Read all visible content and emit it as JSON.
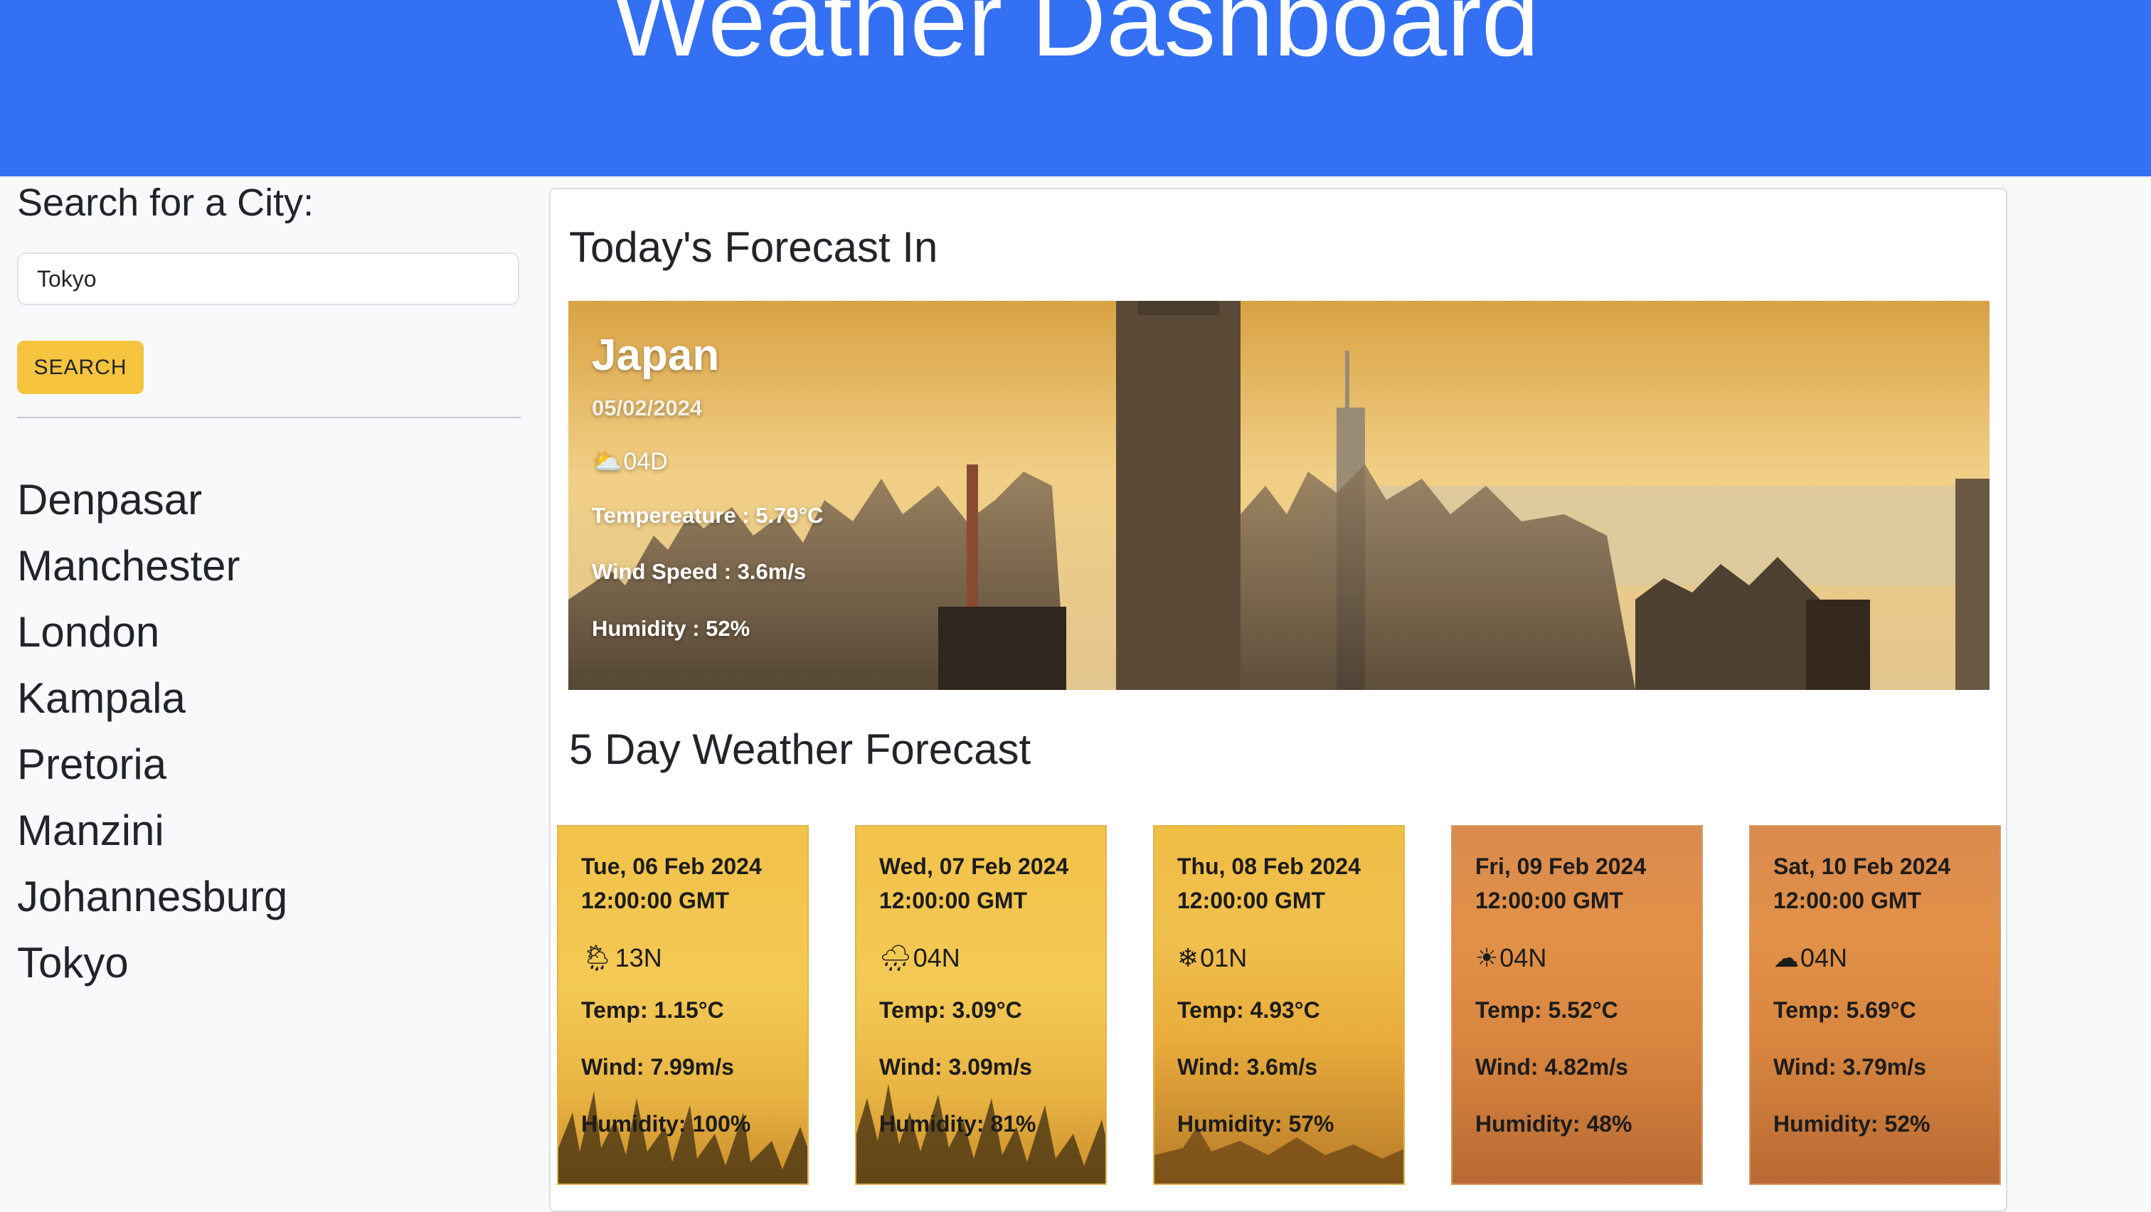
{
  "header": {
    "title": "Weather Dashboard"
  },
  "sidebar": {
    "search_label": "Search for a City:",
    "search_value": "Tokyo",
    "search_button": "SEARCH",
    "cities": [
      "Denpasar",
      "Manchester",
      "London",
      "Kampala",
      "Pretoria",
      "Manzini",
      "Johannesburg",
      "Tokyo"
    ]
  },
  "today": {
    "heading": "Today's Forecast In",
    "country": "Japan",
    "date": "05/02/2024",
    "icon_code": "04D",
    "icon": "sun-cloud-icon",
    "temperature": "Tempereature : 5.79°C",
    "wind": "Wind Speed : 3.6m/s",
    "humidity": "Humidity : 52%"
  },
  "forecast": {
    "heading": "5 Day Weather Forecast",
    "days": [
      {
        "date": "Tue, 06 Feb 2024",
        "time": "12:00:00 GMT",
        "icon_code": "13N",
        "icon": "sun-cloud-rain-icon",
        "temp": "Temp: 1.15°C",
        "wind": "Wind: 7.99m/s",
        "humidity": "Humidity: 100%"
      },
      {
        "date": "Wed, 07 Feb 2024",
        "time": "12:00:00 GMT",
        "icon_code": "04N",
        "icon": "cloud-rain-icon",
        "temp": "Temp: 3.09°C",
        "wind": "Wind: 3.09m/s",
        "humidity": "Humidity: 81%"
      },
      {
        "date": "Thu, 08 Feb 2024",
        "time": "12:00:00 GMT",
        "icon_code": "01N",
        "icon": "snowflake-icon",
        "temp": "Temp: 4.93°C",
        "wind": "Wind: 3.6m/s",
        "humidity": "Humidity: 57%"
      },
      {
        "date": "Fri, 09 Feb 2024",
        "time": "12:00:00 GMT",
        "icon_code": "04N",
        "icon": "sun-icon",
        "temp": "Temp: 5.52°C",
        "wind": "Wind: 4.82m/s",
        "humidity": "Humidity: 48%"
      },
      {
        "date": "Sat, 10 Feb 2024",
        "time": "12:00:00 GMT",
        "icon_code": "04N",
        "icon": "cloud-icon",
        "temp": "Temp: 5.69°C",
        "wind": "Wind: 3.79m/s",
        "humidity": "Humidity: 52%"
      }
    ]
  },
  "colors": {
    "header": "#3370f3",
    "button": "#f7c440",
    "background": "#f8f9fa"
  }
}
